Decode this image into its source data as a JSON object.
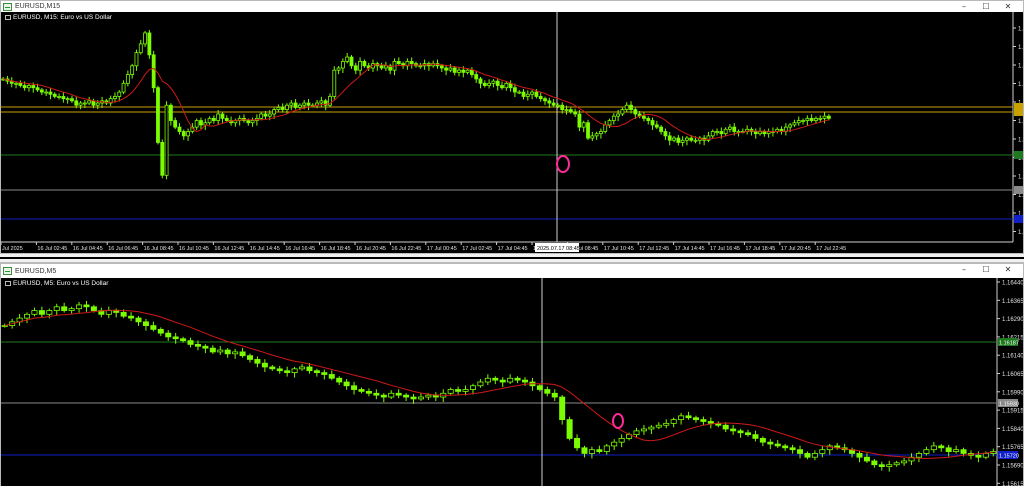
{
  "window1": {
    "title": "EURUSD,M15",
    "symbol_label": "EURUSD, M15:  Euro vs US Dollar",
    "controls": [
      "–",
      "☐",
      "✕"
    ],
    "time_labels": [
      "Jul 2025",
      "16 Jul 02:45",
      "16 Jul 04:45",
      "16 Jul 06:45",
      "16 Jul 08:45",
      "16 Jul 10:45",
      "16 Jul 12:45",
      "16 Jul 14:45",
      "16 Jul 16:45",
      "16 Jul 18:45",
      "16 Jul 20:45",
      "16 Jul 22:45",
      "17 Jul 00:45",
      "17 Jul 02:45",
      "17 Jul 04:45",
      "17 Jul 06:45",
      "17 Jul 08:45",
      "17 Jul 10:45",
      "17 Jul 12:45",
      "17 Jul 14:45",
      "17 Jul 16:45",
      "17 Jul 18:45",
      "17 Jul 20:45",
      "17 Jul 22:45"
    ],
    "crosshair_label": "2025.07.17 08:45",
    "price_labels": [
      "1.1",
      "1.1",
      "1.1",
      "1.1",
      "1.1",
      "1.1",
      "1.1",
      "1.1",
      "1.1",
      "1.1",
      "1.1",
      "1.1"
    ]
  },
  "window2": {
    "title": "EURUSD,M5",
    "symbol_label": "EURUSD, M5:  Euro vs US Dollar",
    "controls": [
      "–",
      "☐",
      "✕"
    ],
    "price_labels": [
      "1.16440",
      "1.16365",
      "1.16290",
      "1.16215",
      "1.16140",
      "1.16065",
      "1.15990",
      "1.15915",
      "1.15840",
      "1.15765",
      "1.15690",
      "1.15615"
    ],
    "boxed_labels": [
      "1.16187",
      "1.15930",
      "1.15720"
    ]
  },
  "colors": {
    "bull": "#7cfc00",
    "bear": "#7cfc00",
    "ma": "#d01818",
    "green_level": "#1f7a1f",
    "gold_level": "#c8a000",
    "blue_level": "#1020c8",
    "grey_level": "#8a8a8a",
    "marker": "#ff2a9a"
  },
  "chart_data": [
    {
      "type": "candlestick",
      "name": "EURUSD M15",
      "closes": [
        0.74,
        0.73,
        0.72,
        0.72,
        0.71,
        0.7,
        0.71,
        0.7,
        0.69,
        0.68,
        0.68,
        0.67,
        0.66,
        0.66,
        0.65,
        0.65,
        0.64,
        0.62,
        0.63,
        0.63,
        0.64,
        0.62,
        0.63,
        0.64,
        0.63,
        0.65,
        0.66,
        0.68,
        0.72,
        0.76,
        0.8,
        0.86,
        0.9,
        0.95,
        0.85,
        0.7,
        0.45,
        0.3,
        0.62,
        0.55,
        0.52,
        0.5,
        0.48,
        0.5,
        0.52,
        0.55,
        0.53,
        0.54,
        0.56,
        0.55,
        0.58,
        0.56,
        0.55,
        0.54,
        0.55,
        0.56,
        0.55,
        0.54,
        0.55,
        0.56,
        0.58,
        0.57,
        0.58,
        0.6,
        0.61,
        0.6,
        0.62,
        0.63,
        0.61,
        0.62,
        0.63,
        0.62,
        0.62,
        0.63,
        0.64,
        0.62,
        0.66,
        0.78,
        0.79,
        0.82,
        0.84,
        0.8,
        0.78,
        0.82,
        0.8,
        0.79,
        0.81,
        0.8,
        0.79,
        0.8,
        0.78,
        0.82,
        0.81,
        0.8,
        0.82,
        0.81,
        0.8,
        0.8,
        0.81,
        0.8,
        0.81,
        0.8,
        0.79,
        0.78,
        0.79,
        0.77,
        0.78,
        0.77,
        0.78,
        0.76,
        0.74,
        0.72,
        0.71,
        0.72,
        0.73,
        0.71,
        0.7,
        0.72,
        0.7,
        0.68,
        0.68,
        0.66,
        0.67,
        0.68,
        0.66,
        0.65,
        0.64,
        0.63,
        0.62,
        0.62,
        0.6,
        0.6,
        0.59,
        0.58,
        0.52,
        0.54,
        0.47,
        0.48,
        0.49,
        0.5,
        0.53,
        0.55,
        0.57,
        0.58,
        0.6,
        0.62,
        0.6,
        0.58,
        0.57,
        0.56,
        0.55,
        0.53,
        0.52,
        0.5,
        0.48,
        0.46,
        0.47,
        0.45,
        0.46,
        0.47,
        0.46,
        0.46,
        0.47,
        0.46,
        0.48,
        0.5,
        0.5,
        0.49,
        0.51,
        0.52,
        0.5,
        0.5,
        0.5,
        0.51,
        0.5,
        0.49,
        0.5,
        0.49,
        0.5,
        0.5,
        0.51,
        0.5,
        0.52,
        0.53,
        0.54,
        0.55,
        0.55,
        0.56,
        0.55,
        0.56,
        0.56,
        0.57,
        0.56
      ]
    },
    {
      "type": "candlestick",
      "name": "EURUSD M5",
      "closes": [
        0.8,
        0.82,
        0.84,
        0.86,
        0.88,
        0.86,
        0.88,
        0.9,
        0.88,
        0.89,
        0.91,
        0.9,
        0.88,
        0.86,
        0.88,
        0.87,
        0.85,
        0.84,
        0.82,
        0.8,
        0.78,
        0.76,
        0.74,
        0.73,
        0.72,
        0.7,
        0.69,
        0.68,
        0.66,
        0.67,
        0.65,
        0.66,
        0.64,
        0.62,
        0.6,
        0.58,
        0.57,
        0.56,
        0.55,
        0.57,
        0.58,
        0.56,
        0.55,
        0.54,
        0.52,
        0.5,
        0.48,
        0.46,
        0.45,
        0.44,
        0.43,
        0.42,
        0.44,
        0.43,
        0.42,
        0.41,
        0.42,
        0.43,
        0.42,
        0.44,
        0.46,
        0.45,
        0.46,
        0.48,
        0.5,
        0.52,
        0.51,
        0.5,
        0.52,
        0.51,
        0.5,
        0.48,
        0.46,
        0.44,
        0.42,
        0.3,
        0.2,
        0.15,
        0.12,
        0.14,
        0.13,
        0.16,
        0.18,
        0.2,
        0.22,
        0.24,
        0.25,
        0.26,
        0.27,
        0.28,
        0.3,
        0.32,
        0.31,
        0.3,
        0.29,
        0.28,
        0.27,
        0.25,
        0.24,
        0.23,
        0.22,
        0.2,
        0.18,
        0.17,
        0.16,
        0.15,
        0.14,
        0.12,
        0.1,
        0.12,
        0.14,
        0.16,
        0.15,
        0.14,
        0.12,
        0.1,
        0.08,
        0.06,
        0.05,
        0.06,
        0.07,
        0.08,
        0.1,
        0.12,
        0.14,
        0.16,
        0.15,
        0.13,
        0.14,
        0.12,
        0.11,
        0.1,
        0.12,
        0.13
      ]
    }
  ]
}
